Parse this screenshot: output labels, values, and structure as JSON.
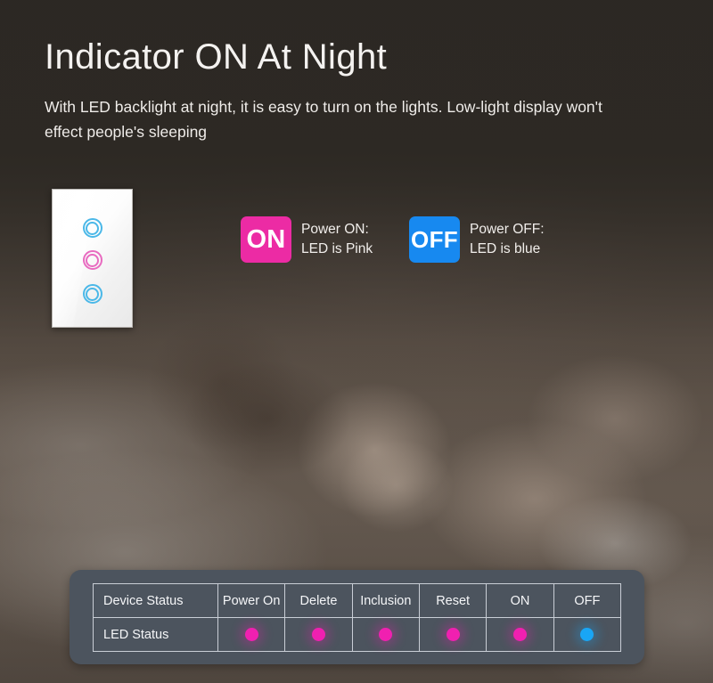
{
  "heading": {
    "title": "Indicator ON At Night",
    "subtitle": "With LED backlight at night, it is easy to turn on the lights. Low-light display won't effect people's sleeping"
  },
  "switch_panel": {
    "indicators": [
      {
        "name": "led-ring-top",
        "color": "#4bb8e8",
        "state": "blue"
      },
      {
        "name": "led-ring-middle",
        "color": "#e86bc0",
        "state": "pink"
      },
      {
        "name": "led-ring-bottom",
        "color": "#4bb8e8",
        "state": "blue"
      }
    ]
  },
  "legend": {
    "on": {
      "badge": "ON",
      "badge_color": "#ec2ba4",
      "line1": "Power ON:",
      "line2": "LED is Pink"
    },
    "off": {
      "badge": "OFF",
      "badge_color": "#1789f0",
      "line1": "Power OFF:",
      "line2": "LED is blue"
    }
  },
  "status_table": {
    "headers": [
      "Device Status",
      "Power On",
      "Delete",
      "Inclusion",
      "Reset",
      "ON",
      "OFF"
    ],
    "row_label": "LED Status",
    "led_colors": [
      "pink",
      "pink",
      "pink",
      "pink",
      "pink",
      "blue"
    ],
    "colors": {
      "pink": "#f020b0",
      "blue": "#19a6f5"
    }
  }
}
